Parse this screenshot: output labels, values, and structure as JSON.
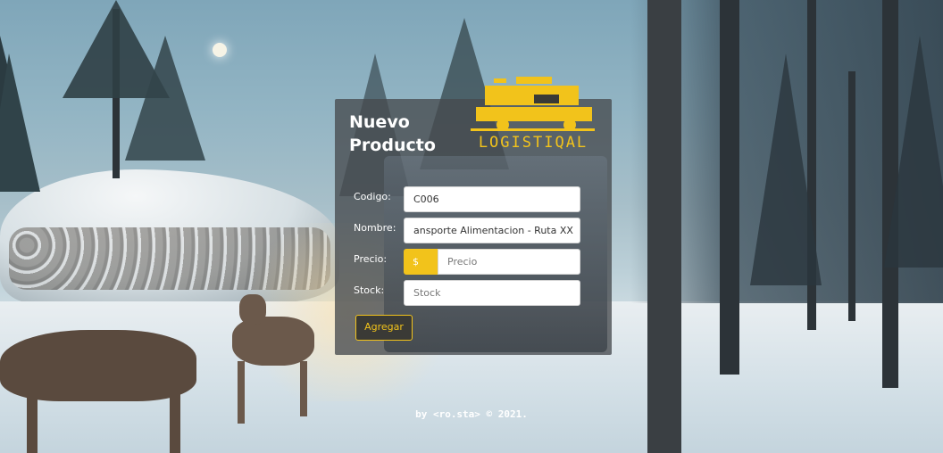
{
  "form": {
    "title_line1": "Nuevo",
    "title_line2": "Producto",
    "logo_text": "LOGISTIQAL",
    "codigo_label": "Codigo:",
    "codigo_value": "C006",
    "nombre_label": "Nombre:",
    "nombre_value": "ansporte Alimentacion - Ruta XX",
    "precio_label": "Precio:",
    "precio_currency": "$",
    "precio_placeholder": "Precio",
    "stock_label": "Stock:",
    "stock_placeholder": "Stock",
    "submit_label": "Agregar"
  },
  "footer": {
    "text": "by <ro.sta> © 2021."
  },
  "colors": {
    "accent": "#f2c31b",
    "card": "#464a4e"
  },
  "icons": [
    "truck-logo-icon"
  ]
}
